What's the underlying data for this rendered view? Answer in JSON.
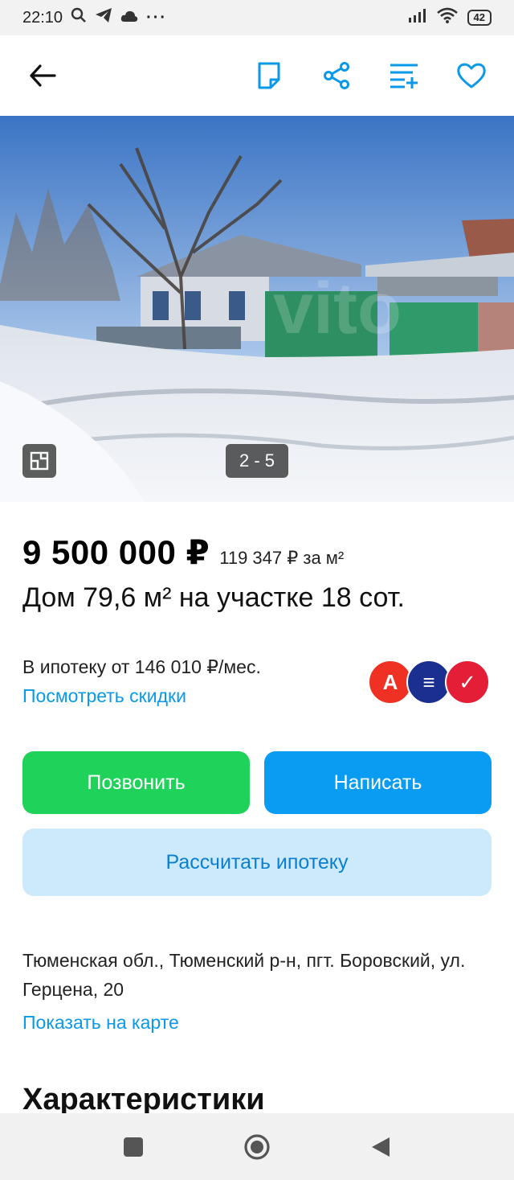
{
  "status_bar": {
    "time": "22:10",
    "dots": "···",
    "battery": "42"
  },
  "listing": {
    "photo_counter": "2 - 5",
    "price": "9 500 000 ₽",
    "price_per_m2": "119 347 ₽ за м²",
    "title": "Дом 79,6 м² на участке 18 сот.",
    "mortgage_text": "В ипотеку от 146 010 ₽/мес.",
    "discount_link": "Посмотреть скидки",
    "banks": [
      {
        "label": "А",
        "color": "#ef3124"
      },
      {
        "label": "≡",
        "color": "#1a2f8f"
      },
      {
        "label": "✓",
        "color": "#e31e36"
      }
    ],
    "call_button": "Позвонить",
    "write_button": "Написать",
    "calc_button": "Рассчитать ипотеку",
    "address": "Тюменская обл., Тюменский р-н, пгт. Боровский, ул. Герцена, 20",
    "map_link": "Показать на карте",
    "section_title": "Характеристики"
  },
  "colors": {
    "accent_blue": "#0a99e8",
    "call_green": "#1ed25a",
    "write_blue": "#0a9bf2",
    "calc_bg": "#cdeafd"
  },
  "icons": {
    "toolbar": [
      "back-arrow-icon",
      "note-icon",
      "share-icon",
      "compare-icon",
      "favorite-heart-icon"
    ],
    "navbar": [
      "recent-apps-icon",
      "home-icon",
      "back-icon"
    ]
  }
}
